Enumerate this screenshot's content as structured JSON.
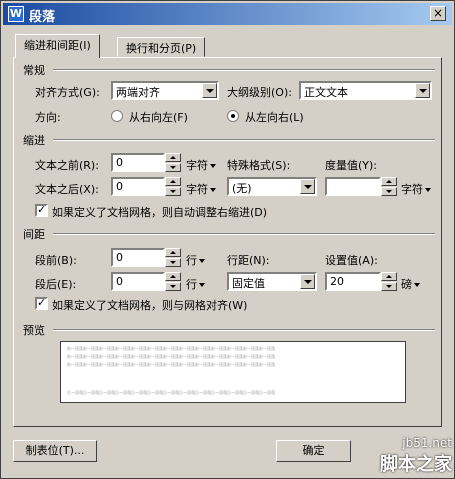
{
  "window": {
    "title": "段落",
    "app_icon": "W",
    "close": "×"
  },
  "tabs": [
    {
      "label": "缩进和间距(I)",
      "active": true
    },
    {
      "label": "换行和分页(P)",
      "active": false
    }
  ],
  "general": {
    "title": "常规",
    "align_label": "对齐方式(G):",
    "align_value": "两端对齐",
    "outline_label": "大纲级别(O):",
    "outline_value": "正文文本",
    "direction_label": "方向:",
    "rtl_label": "从右向左(F)",
    "ltr_label": "从左向右(L)"
  },
  "indent": {
    "title": "缩进",
    "before_label": "文本之前(R):",
    "before_value": "0",
    "before_unit": "字符",
    "after_label": "文本之后(X):",
    "after_value": "0",
    "after_unit": "字符",
    "special_label": "特殊格式(S):",
    "special_value": "(无)",
    "measure_label": "度量值(Y):",
    "measure_value": "",
    "measure_unit": "字符",
    "grid_checkbox": "如果定义了文档网格，则自动调整右缩进(D)"
  },
  "spacing": {
    "title": "间距",
    "before_label": "段前(B):",
    "before_value": "0",
    "before_unit": "行",
    "after_label": "段后(E):",
    "after_value": "0",
    "after_unit": "行",
    "line_label": "行距(N):",
    "line_value": "固定值",
    "set_label": "设置值(A):",
    "set_value": "20",
    "set_unit": "磅",
    "grid_checkbox": "如果定义了文档网格，则与网格对齐(W)"
  },
  "preview": {
    "title": "预览",
    "sample_prev": "前一段落前一段落前一段落前一段落前一段落前一段落前一段落前一段落前一段落前一段落前一段落前一段落前一段落",
    "sample_next": "后一段落后一段落后一段落后一段落后一段落后一段落后一段落后一段落后一段落后一段落后一段落后一段落后一段落"
  },
  "buttons": {
    "tabs": "制表位(T)...",
    "ok": "确定"
  },
  "watermark": {
    "url": "jb51.net",
    "name": "脚本之家"
  }
}
